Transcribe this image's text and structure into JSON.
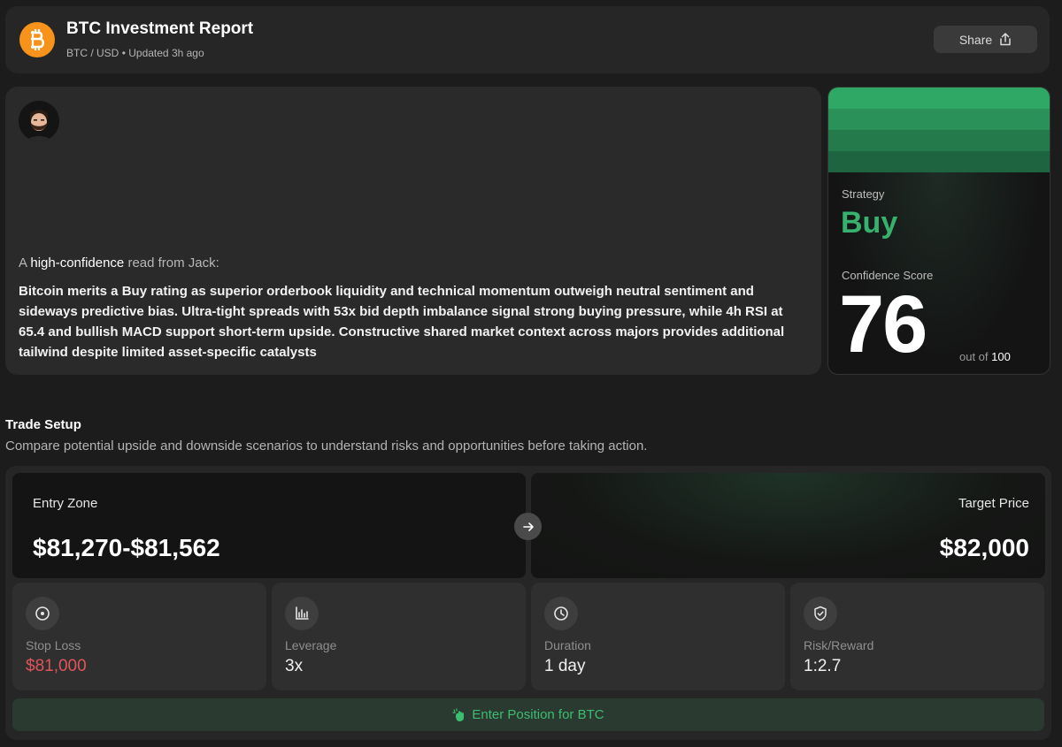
{
  "header": {
    "title": "BTC Investment Report",
    "pair": "BTC / USD",
    "separator": "•",
    "updated": "Updated 3h ago",
    "share_label": "Share"
  },
  "summary": {
    "read_prefix": "A",
    "read_highlight": "high-confidence",
    "read_suffix": "read from Jack:",
    "text": "Bitcoin merits a Buy rating as superior orderbook liquidity and technical momentum outweigh neutral sentiment and sideways predictive bias. Ultra-tight spreads with 53x bid depth imbalance signal strong buying pressure, while 4h RSI at 65.4 and bullish MACD support short-term upside. Constructive shared market context across majors provides additional tailwind despite limited asset-specific catalysts"
  },
  "strategy": {
    "label": "Strategy",
    "value": "Buy",
    "confidence_label": "Confidence Score",
    "confidence_value": "76",
    "out_of_prefix": "out of",
    "out_of_value": "100",
    "band_colors": [
      "#2fa866",
      "#2a9159",
      "#257a4c",
      "#1f6440"
    ]
  },
  "trade_setup": {
    "title": "Trade Setup",
    "subtitle": "Compare potential upside and downside scenarios to understand risks and opportunities before taking action.",
    "entry_label": "Entry Zone",
    "entry_value": "$81,270-$81,562",
    "target_label": "Target Price",
    "target_value": "$82,000",
    "metrics": [
      {
        "icon": "target-icon",
        "label": "Stop Loss",
        "value": "$81,000"
      },
      {
        "icon": "bar-chart-icon",
        "label": "Leverage",
        "value": "3x"
      },
      {
        "icon": "clock-icon",
        "label": "Duration",
        "value": "1 day"
      },
      {
        "icon": "shield-check-icon",
        "label": "Risk/Reward",
        "value": "1:2.7"
      }
    ],
    "cta_label": "Enter Position for BTC"
  },
  "colors": {
    "accent_green": "#36b26e",
    "loss_red": "#e0555a",
    "btc_orange": "#f7931a"
  }
}
